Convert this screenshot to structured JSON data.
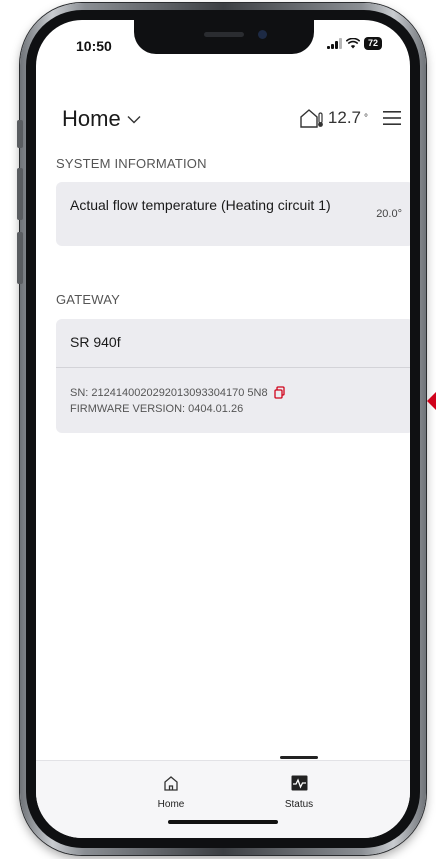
{
  "status_bar": {
    "time": "10:50",
    "battery": "72"
  },
  "header": {
    "title": "Home",
    "temperature": "12.7",
    "temperature_unit": "°"
  },
  "system_information": {
    "section_label": "SYSTEM INFORMATION",
    "items": [
      {
        "name": "Actual flow temperature (Heating circuit 1)",
        "value": "20.0°"
      }
    ]
  },
  "gateway": {
    "section_label": "GATEWAY",
    "name": "SR 940f",
    "serial": "SN: 2124140020292013093304170 5N8",
    "firmware": "FIRMWARE VERSION: 0404.01.26"
  },
  "bottom_nav": {
    "items": [
      {
        "label": "Home",
        "icon": "home-icon",
        "active": false
      },
      {
        "label": "Status",
        "icon": "status-icon",
        "active": true
      }
    ]
  },
  "colors": {
    "accent_red": "#d0021b",
    "card_background": "#ececf0"
  }
}
